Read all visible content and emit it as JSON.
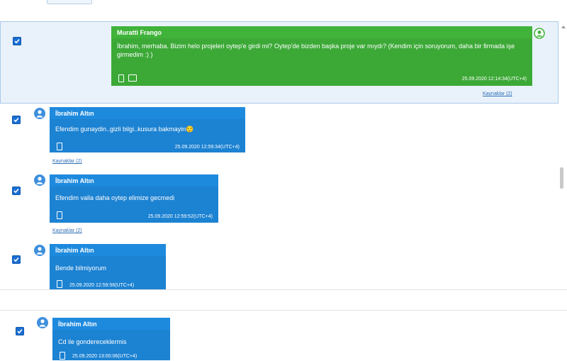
{
  "messages": [
    {
      "sender": "Muratti Frango",
      "text": "İbrahim, merhaba. Bizim helo projeleri oytep'e girdi mi? Oytep'de bizden başka proje var mıydı? (Kendim için soruyorum, daha bir firmada işe girmedim :) )",
      "timestamp": "25.09.2020 12:14:34(UTC+4)",
      "sources": "Kaynaklar (2)",
      "checked": true,
      "color": "#40b33a"
    },
    {
      "sender": "İbrahim Altın",
      "text": "Efendim gunaydin..gizli bilgi..kusura bakmayin😌",
      "timestamp": "25.09.2020 12:59:34(UTC+4)",
      "sources": "Kaynaklar (2)",
      "checked": true,
      "color": "#1e8ade"
    },
    {
      "sender": "İbrahim Altın",
      "text": "Efendim valla daha oytep elimize gecmedi",
      "timestamp": "25.09.2020 12:59:52(UTC+4)",
      "sources": "Kaynaklar (2)",
      "checked": true,
      "color": "#1e8ade"
    },
    {
      "sender": "İbrahim Altın",
      "text": "Bende bilmiyorum",
      "timestamp": "25.09.2020 12:59:56(UTC+4)",
      "checked": true,
      "color": "#1e8ade"
    },
    {
      "sender": "İbrahim Altın",
      "text": "Cd ile gondereceklermis",
      "timestamp": "25.09.2020 13:00:06(UTC+4)",
      "checked": true,
      "color": "#1e8ade"
    }
  ]
}
